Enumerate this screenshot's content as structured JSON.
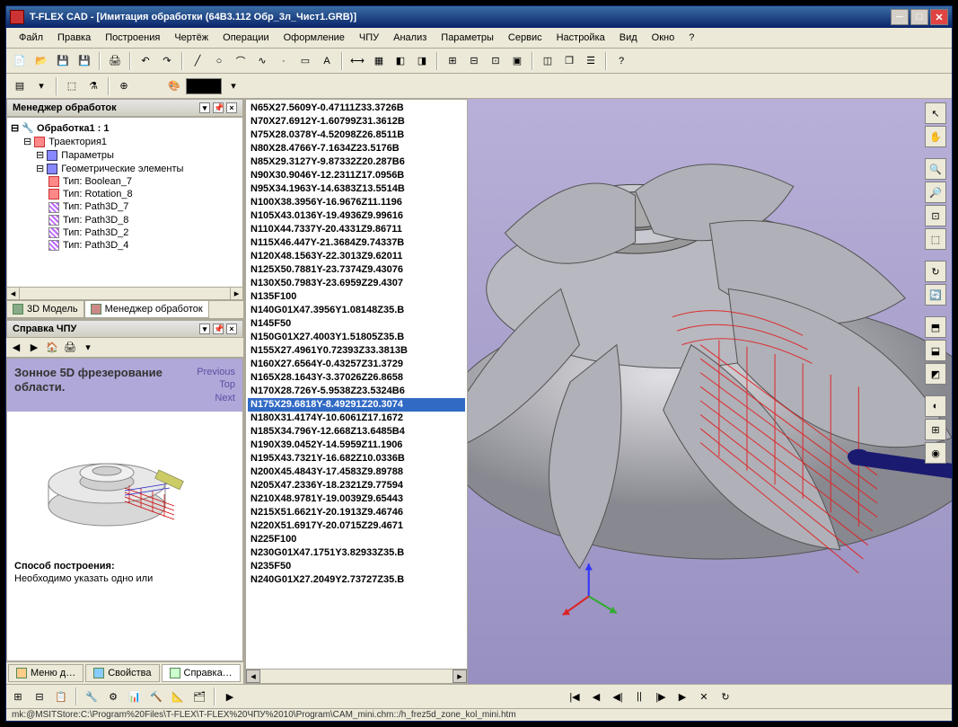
{
  "title": "T-FLEX CAD - [Имитация обработки (64В3.112 Обр_3л_Чист1.GRB)]",
  "menu": [
    "Файл",
    "Правка",
    "Построения",
    "Чертёж",
    "Операции",
    "Оформление",
    "ЧПУ",
    "Анализ",
    "Параметры",
    "Сервис",
    "Настройка",
    "Вид",
    "Окно",
    "?"
  ],
  "manager": {
    "title": "Менеджер обработок",
    "root": "Обработка1 : 1",
    "items": [
      {
        "label": "Траектория1",
        "ind": 1,
        "ic": "red"
      },
      {
        "label": "Параметры",
        "ind": 2,
        "ic": "blue"
      },
      {
        "label": "Геометрические элементы",
        "ind": 2,
        "ic": "blue"
      },
      {
        "label": "Тип: Boolean_7",
        "ind": 3,
        "ic": "red"
      },
      {
        "label": "Тип: Rotation_8",
        "ind": 3,
        "ic": "red"
      },
      {
        "label": "Тип: Path3D_7",
        "ind": 3,
        "ic": "pdot"
      },
      {
        "label": "Тип: Path3D_8",
        "ind": 3,
        "ic": "pdot"
      },
      {
        "label": "Тип: Path3D_2",
        "ind": 3,
        "ic": "pdot"
      },
      {
        "label": "Тип: Path3D_4",
        "ind": 3,
        "ic": "pdot"
      }
    ],
    "tabs": [
      "3D Модель",
      "Менеджер обработок"
    ]
  },
  "help": {
    "title": "Справка ЧПУ",
    "heading": "Зонное 5D фрезерование области.",
    "links": [
      "Previous",
      "Top",
      "Next"
    ],
    "section": "Способ построения:",
    "text": "Необходимо указать одно или"
  },
  "bottomTabs": [
    "Меню д…",
    "Свойства",
    "Справка…"
  ],
  "gcode": [
    "N65X27.5609Y-0.47111Z33.3726B",
    "N70X27.6912Y-1.60799Z31.3612B",
    "N75X28.0378Y-4.52098Z26.8511B",
    "N80X28.4766Y-7.1634Z23.5176B",
    "N85X29.3127Y-9.87332Z20.287B6",
    "N90X30.9046Y-12.2311Z17.0956B",
    "N95X34.1963Y-14.6383Z13.5514B",
    "N100X38.3956Y-16.9676Z11.1196",
    "N105X43.0136Y-19.4936Z9.99616",
    "N110X44.7337Y-20.4331Z9.86711",
    "N115X46.447Y-21.3684Z9.74337B",
    "N120X48.1563Y-22.3013Z9.62011",
    "N125X50.7881Y-23.7374Z9.43076",
    "N130X50.7983Y-23.6959Z29.4307",
    "N135F100",
    "N140G01X47.3956Y1.08148Z35.B",
    "N145F50",
    "N150G01X27.4003Y1.51805Z35.B",
    "N155X27.4961Y0.72393Z33.3813B",
    "N160X27.6564Y-0.43257Z31.3729",
    "N165X28.1643Y-3.37026Z26.8658",
    "N170X28.726Y-5.9538Z23.5324B6",
    "N175X29.6818Y-8.49291Z20.3074",
    "N180X31.4174Y-10.6061Z17.1672",
    "N185X34.796Y-12.668Z13.6485B4",
    "N190X39.0452Y-14.5959Z11.1906",
    "N195X43.7321Y-16.682Z10.0336B",
    "N200X45.4843Y-17.4583Z9.89788",
    "N205X47.2336Y-18.2321Z9.77594",
    "N210X48.9781Y-19.0039Z9.65443",
    "N215X51.6621Y-20.1913Z9.46746",
    "N220X51.6917Y-20.0715Z29.4671",
    "N225F100",
    "N230G01X47.1751Y3.82933Z35.B",
    "N235F50",
    "N240G01X27.2049Y2.73727Z35.B"
  ],
  "gcodeSelected": 22,
  "playback": [
    "|◀",
    "◀",
    "◀|",
    "||",
    "|▶",
    "▶",
    "✕",
    "↻"
  ],
  "status": "mk:@MSITStore:C:\\Program%20Files\\T-FLEX\\T-FLEX%20ЧПУ%2010\\Program\\CAM_mini.chm::/h_frez5d_zone_kol_mini.htm"
}
